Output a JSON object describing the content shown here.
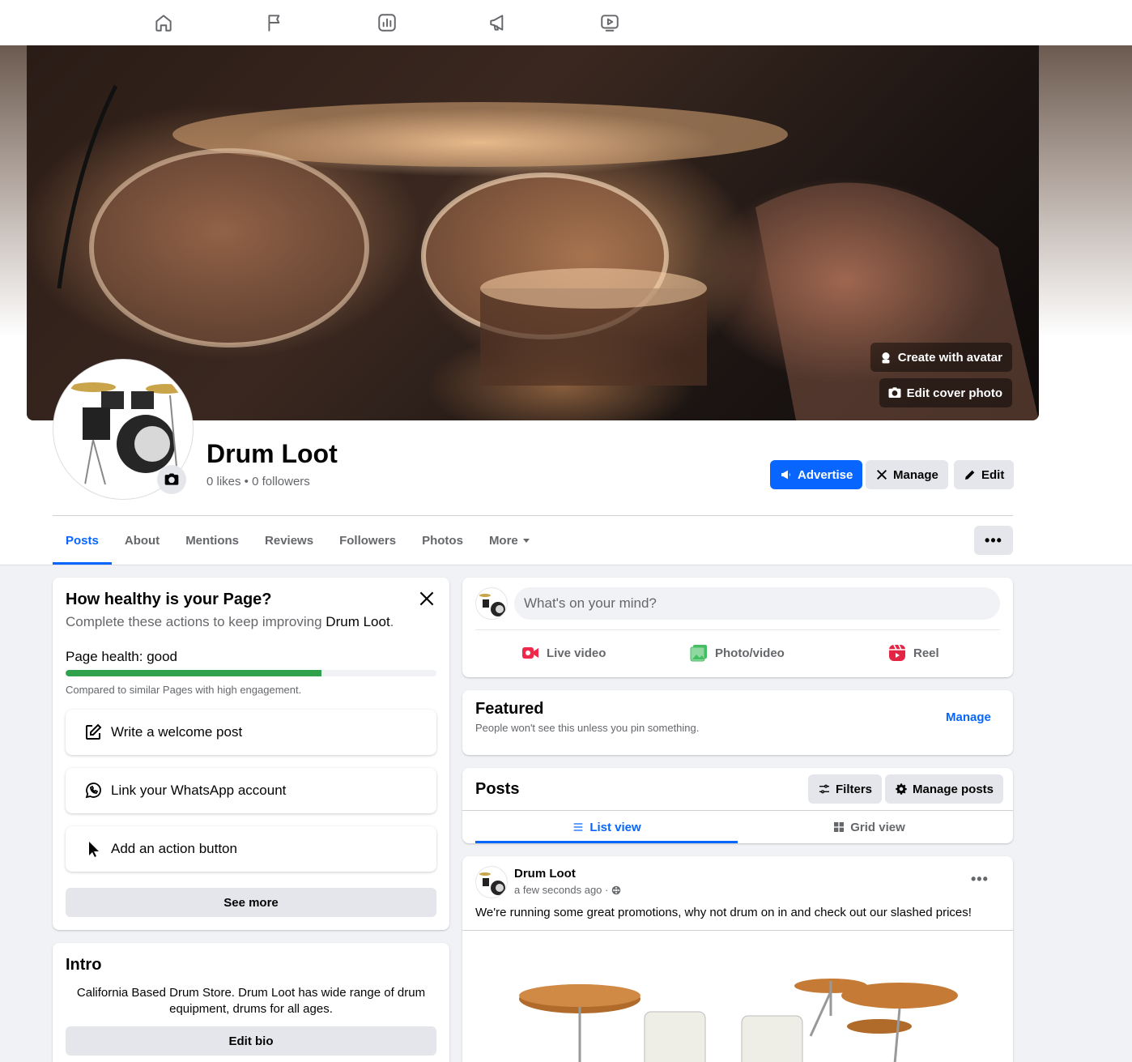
{
  "topnav": {
    "icons": [
      "home-icon",
      "flag-icon",
      "insights-icon",
      "megaphone-icon",
      "video-icon"
    ]
  },
  "cover": {
    "create_avatar_label": "Create with avatar",
    "edit_cover_label": "Edit cover photo"
  },
  "page": {
    "name": "Drum Loot",
    "stats": "0 likes • 0 followers"
  },
  "actions": {
    "advertise": "Advertise",
    "manage": "Manage",
    "edit": "Edit"
  },
  "tabs": [
    "Posts",
    "About",
    "Mentions",
    "Reviews",
    "Followers",
    "Photos",
    "More"
  ],
  "tab_more_btn": "•••",
  "health": {
    "title": "How healthy is your Page?",
    "subtitle_prefix": "Complete these actions to keep improving ",
    "subtitle_page": "Drum Loot",
    "subtitle_suffix": ".",
    "label": "Page health: good",
    "progress": 0.69,
    "compare": "Compared to similar Pages with high engagement.",
    "tasks": [
      "Write a welcome post",
      "Link your WhatsApp account",
      "Add an action button"
    ],
    "see_more": "See more"
  },
  "intro": {
    "title": "Intro",
    "bio": "California Based Drum Store. Drum Loot has wide range of drum equipment, drums for all ages.",
    "edit_bio": "Edit bio"
  },
  "composer": {
    "placeholder": "What's on your mind?",
    "live": "Live video",
    "photo": "Photo/video",
    "reel": "Reel"
  },
  "featured": {
    "title": "Featured",
    "sub": "People won't see this unless you pin something.",
    "manage": "Manage"
  },
  "posts_section": {
    "title": "Posts",
    "filters": "Filters",
    "manage_posts": "Manage posts",
    "list_view": "List view",
    "grid_view": "Grid view"
  },
  "post": {
    "author": "Drum Loot",
    "time": "a few seconds ago ·",
    "text": "We're running some great promotions, why not drum on in and check out our slashed prices!",
    "dots": "•••"
  },
  "colors": {
    "accent": "#0866ff",
    "health_bar": "#31a24c",
    "live_red": "#f02849",
    "photo_green": "#45bd62"
  }
}
